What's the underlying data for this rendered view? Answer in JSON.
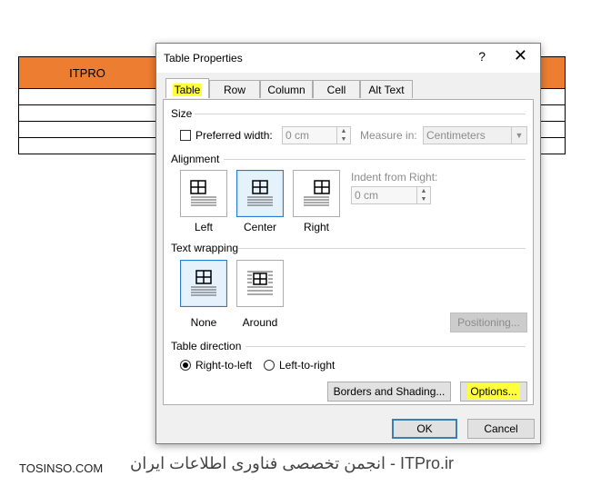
{
  "document": {
    "table_header": "ITPRO"
  },
  "dialog": {
    "title": "Table Properties",
    "help": "?",
    "close": "✕",
    "tabs": [
      "Table",
      "Row",
      "Column",
      "Cell",
      "Alt Text"
    ],
    "size": {
      "heading": "Size",
      "preferred_width_label": "Preferred width:",
      "preferred_width_value": "0 cm",
      "measure_in_label": "Measure in:",
      "measure_in_value": "Centimeters"
    },
    "alignment": {
      "heading": "Alignment",
      "options": [
        "Left",
        "Center",
        "Right"
      ],
      "indent_label": "Indent from Right:",
      "indent_value": "0 cm"
    },
    "text_wrapping": {
      "heading": "Text wrapping",
      "options": [
        "None",
        "Around"
      ],
      "positioning_button": "Positioning..."
    },
    "table_direction": {
      "heading": "Table direction",
      "rtl_label": "Right-to-left",
      "ltr_label": "Left-to-right"
    },
    "borders_button": "Borders and Shading...",
    "options_button": "Options...",
    "ok_button": "OK",
    "cancel_button": "Cancel"
  },
  "watermark": {
    "left": "TOSINSO.COM",
    "right": "ITPro.ir - انجمن تخصصی فناوری اطلاعات ایران"
  }
}
